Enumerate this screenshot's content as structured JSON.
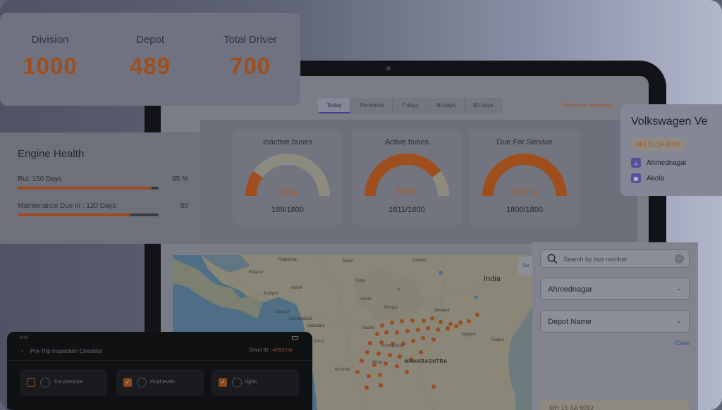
{
  "stats": [
    {
      "label": "Division",
      "value": "1000"
    },
    {
      "label": "Depot",
      "value": "489"
    },
    {
      "label": "Total Driver",
      "value": "700"
    }
  ],
  "period_tabs": [
    "Today",
    "Tomorrow",
    "7 days",
    "30 days",
    "90 days"
  ],
  "predictive_link": "Predictive Maintenar",
  "engine_health": {
    "title": "Engine Health",
    "rows": [
      {
        "label": "Rul: 150 Days",
        "value": "95 %",
        "fraction": 0.95
      },
      {
        "label": "Maintenance Due in : 120 Days",
        "value": "80",
        "fraction": 0.8
      }
    ]
  },
  "gauges": [
    {
      "title": "Inactive buses",
      "percent_label": "20%",
      "fraction": 0.2,
      "count": "189/1800"
    },
    {
      "title": "Active buses",
      "percent_label": "80%",
      "fraction": 0.8,
      "count": "1611/1800"
    },
    {
      "title": "Due For Service",
      "percent_label": "100%",
      "fraction": 1.0,
      "count": "1800/1800"
    }
  ],
  "vehicle": {
    "name": "Volkswagen Ve",
    "plate": "MH 15 SA 6092",
    "locations": [
      "Ahmednagar",
      "Akola"
    ]
  },
  "map": {
    "label_india": "India",
    "label_region": "MAHARASHTRA",
    "zoom_text": "So",
    "city_labels": [
      "Bikaner",
      "Rajasthan",
      "Ajmer",
      "Jodhpur",
      "Udaipur",
      "Vadodara",
      "Ahmedabad",
      "Surat",
      "Bhopal",
      "Jabalpur",
      "Nagpur",
      "Aurangabad",
      "Nashik",
      "Pune",
      "Mumbai",
      "Indore",
      "Gwalior",
      "Jaipur",
      "Kota",
      "Raipur"
    ]
  },
  "filters": {
    "search_placeholder": "Search by bus number",
    "search_clear": "×",
    "district_value": "Ahmednagar",
    "depot_value": "Depot Name",
    "clear_label": "Clear",
    "bottom_plate": "MH 15 SA 6092"
  },
  "mobile": {
    "time": "9:41",
    "back_icon": "‹",
    "title": "Pre-Trip Inspection Checklist",
    "driver_label": "Driver ID :",
    "driver_id": "#R56234",
    "checklist": [
      {
        "label": "Tire pressure",
        "checked": false
      },
      {
        "label": "Fluid levels",
        "checked": true
      },
      {
        "label": "lights",
        "checked": true
      }
    ]
  },
  "colors": {
    "accent": "#9e4f1d",
    "gauge_track": "#8d8a80"
  }
}
